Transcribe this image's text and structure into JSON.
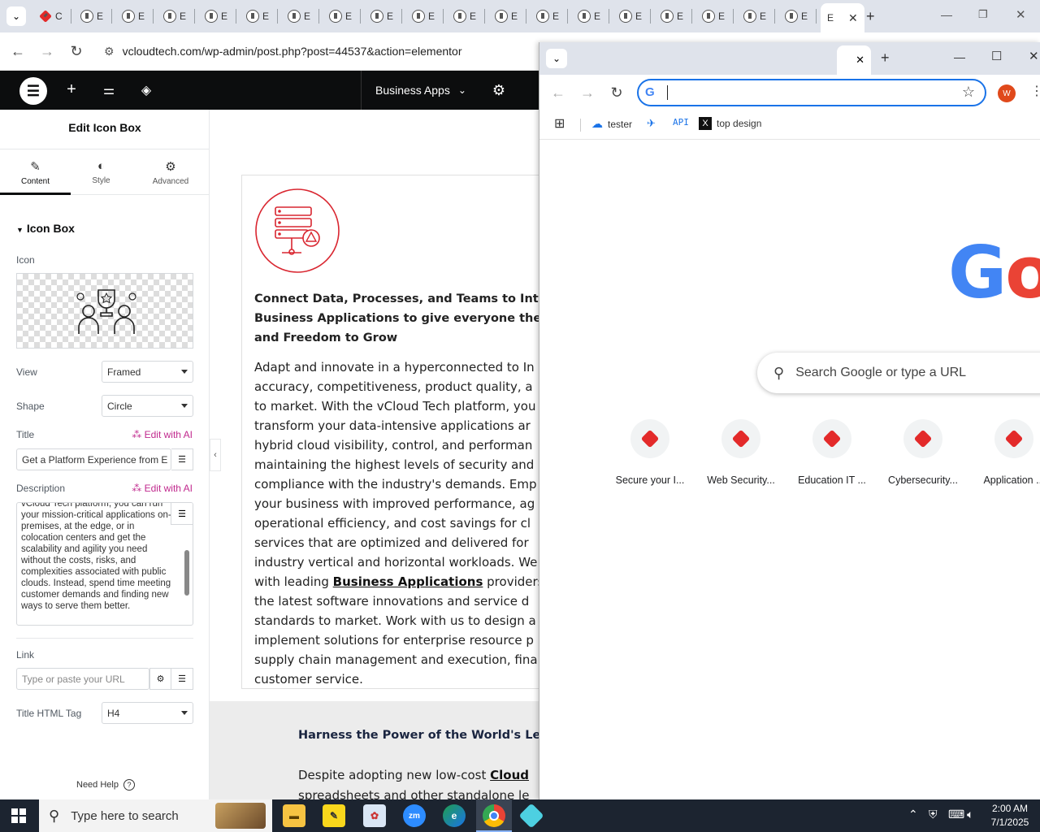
{
  "browser": {
    "tabs_short_labels": [
      "C",
      "E",
      "E",
      "E",
      "E",
      "E",
      "E",
      "E",
      "E",
      "E",
      "E",
      "E",
      "E",
      "E",
      "E",
      "E",
      "E",
      "E",
      "E",
      "E"
    ],
    "active_tab_label": "E",
    "new_tab": "+",
    "url": "vcloudtech.com/wp-admin/post.php?post=44537&action=elementor"
  },
  "elementor": {
    "site_label": "Business Apps",
    "panel_title": "Edit Icon Box",
    "tabs": [
      {
        "label": "Content",
        "icon": "pencil-icon"
      },
      {
        "label": "Style",
        "icon": "contrast-icon"
      },
      {
        "label": "Advanced",
        "icon": "gear-icon"
      }
    ],
    "section_title": "Icon Box",
    "icon_label": "Icon",
    "view_label": "View",
    "view_value": "Framed",
    "shape_label": "Shape",
    "shape_value": "Circle",
    "title_label": "Title",
    "edit_with_ai": "Edit with AI",
    "title_value": "Get a Platform Experience from E",
    "description_label": "Description",
    "description_value": "vCloud Tech platform, you can run your mission-critical applications on-premises, at the edge, or in colocation centers and get the scalability and agility you need without the costs, risks, and complexities associated with public clouds. Instead, spend time meeting customer demands and finding new ways to serve them better.",
    "link_label": "Link",
    "link_placeholder": "Type or paste your URL",
    "html_tag_label": "Title HTML Tag",
    "html_tag_value": "H4",
    "need_help": "Need Help"
  },
  "canvas": {
    "card_title": "Connect Data, Processes, and Teams to Intelli Business Applications to give everyone the In and Freedom to Grow",
    "card_title_lines": [
      "Connect Data, Processes, and Teams to Intelli",
      "Business Applications to give everyone the In",
      "and Freedom to Grow"
    ],
    "card_body_lines": [
      "Adapt and innovate in a hyperconnected to In",
      "accuracy, competitiveness, product quality, a",
      "to market. With the vCloud Tech platform, you",
      "transform your data-intensive applications ar",
      "hybrid cloud visibility, control, and performan",
      "maintaining the highest levels of security and",
      "compliance with the industry's demands. Emp",
      "your business with improved performance, ag",
      "operational efficiency, and cost savings for cl",
      "services that are optimized and delivered for",
      "industry vertical and horizontal workloads. We",
      "with leading |Business Applications| providers",
      "the latest software innovations and service d",
      "standards to market. Work with us to design a",
      "implement solutions for enterprise resource p",
      "supply chain management and execution, fina",
      "customer service."
    ],
    "link_text": "Business Applications",
    "section2_title": "Harness the Power of the World's Lead",
    "section2_body": "Despite adopting new low-cost",
    "section2_link": "Cloud",
    "section2_tail": "spreadsheets and other standalone le"
  },
  "popup": {
    "bookmarks": [
      {
        "label": "tester",
        "icon": "cloud-icon"
      },
      {
        "label": "",
        "icon": "bird-icon"
      },
      {
        "label": "API",
        "icon": "text-icon"
      },
      {
        "label": "top design",
        "icon": "x-logo-icon"
      }
    ],
    "search_placeholder": "Search Google or type a URL",
    "shortcuts": [
      "Secure your I...",
      "Web Security...",
      "Education IT ...",
      "Cybersecurity...",
      "Application ..."
    ],
    "logo_partial": "Go"
  },
  "taskbar": {
    "search_placeholder": "Type here to search",
    "time": "2:00 AM",
    "date": "7/1/2025",
    "apps": [
      "file-explorer-icon",
      "sticky-notes-icon",
      "paint-icon",
      "zoom-icon",
      "edge-icon",
      "chrome-icon",
      "app-icon"
    ]
  },
  "colors": {
    "elementor_dark": "#0c0d0e",
    "ai_pink": "#c12a8e",
    "icon_red": "#d92630",
    "google_blue": "#4285f4",
    "google_red": "#ea4335",
    "taskbar": "#1c2430"
  }
}
